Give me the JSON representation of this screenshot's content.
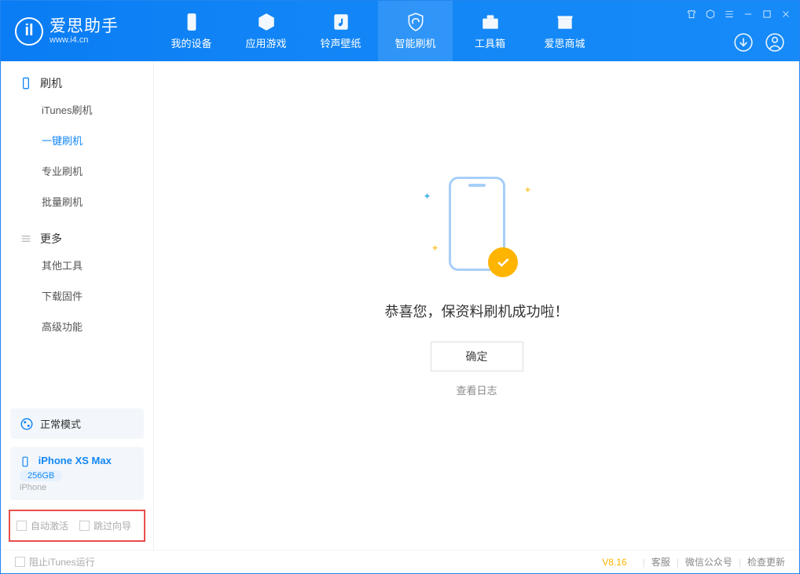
{
  "app": {
    "name": "爱思助手",
    "url": "www.i4.cn"
  },
  "nav": {
    "tabs": [
      {
        "label": "我的设备"
      },
      {
        "label": "应用游戏"
      },
      {
        "label": "铃声壁纸"
      },
      {
        "label": "智能刷机"
      },
      {
        "label": "工具箱"
      },
      {
        "label": "爱思商城"
      }
    ]
  },
  "sidebar": {
    "group1_title": "刷机",
    "group1_items": [
      "iTunes刷机",
      "一键刷机",
      "专业刷机",
      "批量刷机"
    ],
    "active_index": 1,
    "group2_title": "更多",
    "group2_items": [
      "其他工具",
      "下载固件",
      "高级功能"
    ],
    "mode": "正常模式",
    "device": {
      "name": "iPhone XS Max",
      "storage": "256GB",
      "type": "iPhone"
    },
    "checkbox1": "自动激活",
    "checkbox2": "跳过向导"
  },
  "main": {
    "success_text": "恭喜您，保资料刷机成功啦！",
    "ok_button": "确定",
    "log_link": "查看日志"
  },
  "footer": {
    "block_itunes": "阻止iTunes运行",
    "version": "V8.16",
    "links": [
      "客服",
      "微信公众号",
      "检查更新"
    ]
  }
}
